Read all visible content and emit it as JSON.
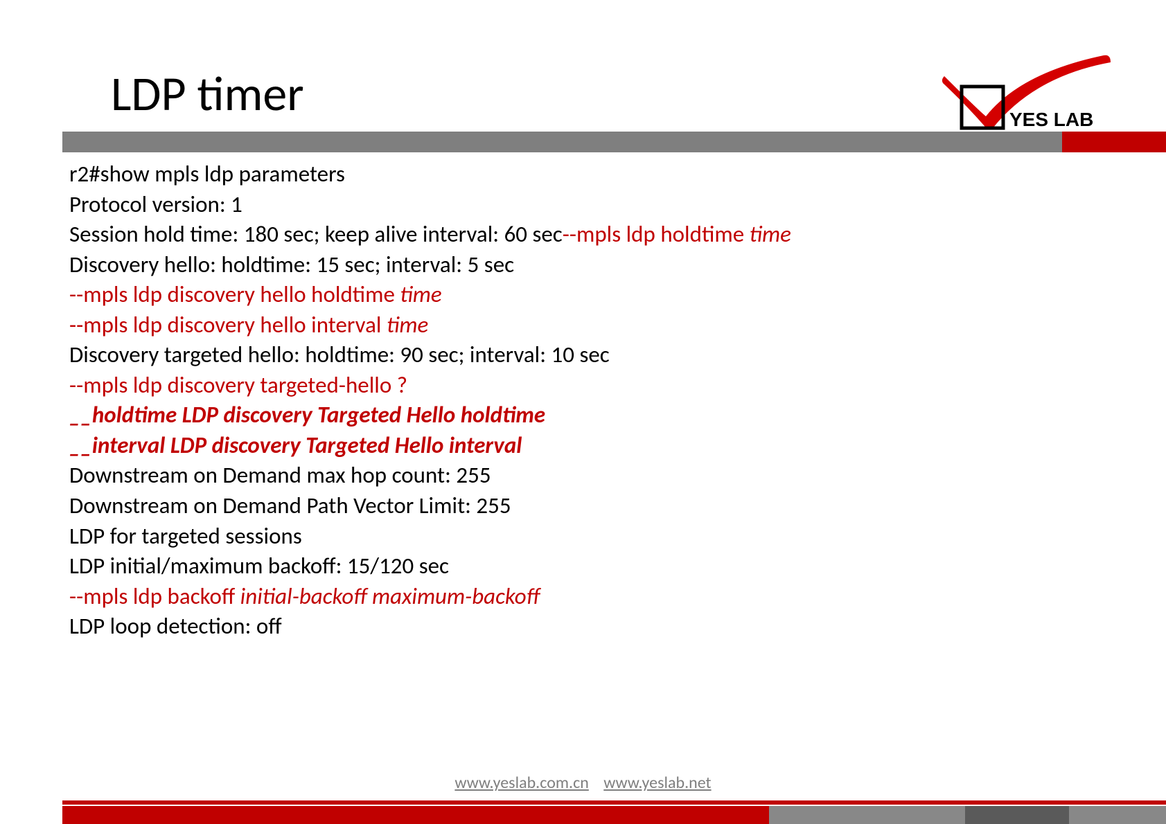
{
  "title": "LDP timer",
  "logo": {
    "text": "YES LAB"
  },
  "lines": {
    "l1": "r2#show mpls ldp parameters",
    "l2": "Protocol version: 1",
    "l3a": "Session hold time: 180 sec; keep alive interval: 60 sec",
    "l3b": "--mpls ldp holdtime ",
    "l3c": "time",
    "l4": "Discovery hello: holdtime: 15 sec; interval: 5 sec",
    "l5a": "--mpls ldp discovery hello holdtime ",
    "l5b": "time",
    "l6a": "--mpls ldp discovery hello interval ",
    "l6b": "time",
    "l7": "Discovery targeted hello: holdtime: 90 sec; interval: 10 sec",
    "l8": "--mpls ldp discovery targeted-hello ?",
    "l9a": "__",
    "l9b": "holdtime  LDP discovery Targeted Hello holdtime",
    "l10a": "__",
    "l10b": "interval  LDP discovery Targeted Hello interval",
    "l11": "Downstream on Demand max hop count: 255",
    "l12": "Downstream on Demand Path Vector Limit: 255",
    "l13": "LDP for targeted sessions",
    "l14": "LDP initial/maximum backoff: 15/120 sec",
    "l15a": "--mpls ldp backoff ",
    "l15b": "initial-backoff maximum-backoff",
    "l16": "LDP loop detection: off"
  },
  "footer": {
    "link1": "www.yeslab.com.cn",
    "link2": "www.yeslab.net"
  }
}
